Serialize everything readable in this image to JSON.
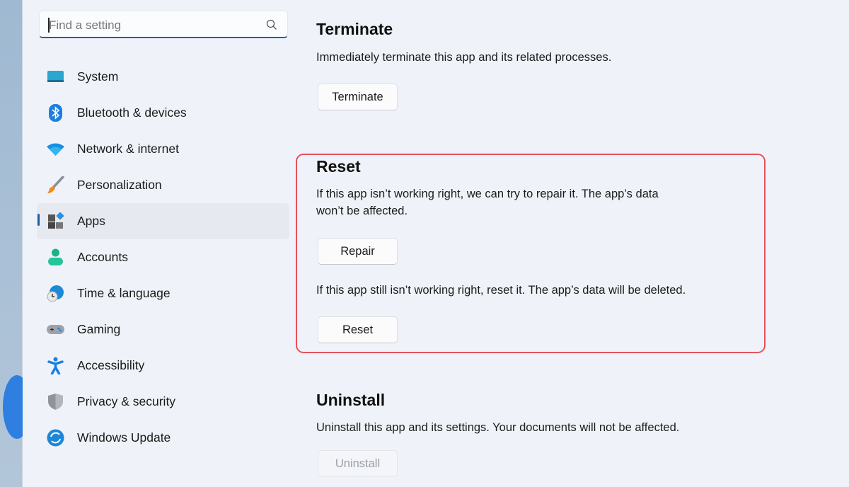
{
  "search": {
    "placeholder": "Find a setting",
    "icon": "search-icon"
  },
  "sidebar": {
    "items": [
      {
        "label": "System",
        "icon": "system-icon"
      },
      {
        "label": "Bluetooth & devices",
        "icon": "bluetooth-icon"
      },
      {
        "label": "Network & internet",
        "icon": "wifi-icon"
      },
      {
        "label": "Personalization",
        "icon": "brush-icon"
      },
      {
        "label": "Apps",
        "icon": "apps-icon",
        "selected": true
      },
      {
        "label": "Accounts",
        "icon": "account-icon"
      },
      {
        "label": "Time & language",
        "icon": "time-language-icon"
      },
      {
        "label": "Gaming",
        "icon": "gamepad-icon"
      },
      {
        "label": "Accessibility",
        "icon": "accessibility-icon"
      },
      {
        "label": "Privacy & security",
        "icon": "shield-icon"
      },
      {
        "label": "Windows Update",
        "icon": "update-icon"
      }
    ]
  },
  "terminate": {
    "title": "Terminate",
    "description": "Immediately terminate this app and its related processes.",
    "button": "Terminate"
  },
  "reset": {
    "title": "Reset",
    "repair_description_1": "If this app isn’t working right, we can try to repair it. The app’s data",
    "repair_description_2": "won’t be affected.",
    "repair_button": "Repair",
    "reset_description": "If this app still isn’t working right, reset it. The app’s data will be deleted.",
    "reset_button": "Reset",
    "highlight_color": "#e5525b"
  },
  "uninstall": {
    "title": "Uninstall",
    "description": "Uninstall this app and its settings. Your documents will not be affected.",
    "button": "Uninstall",
    "disabled": true
  },
  "colors": {
    "accent": "#1f5fa0"
  }
}
